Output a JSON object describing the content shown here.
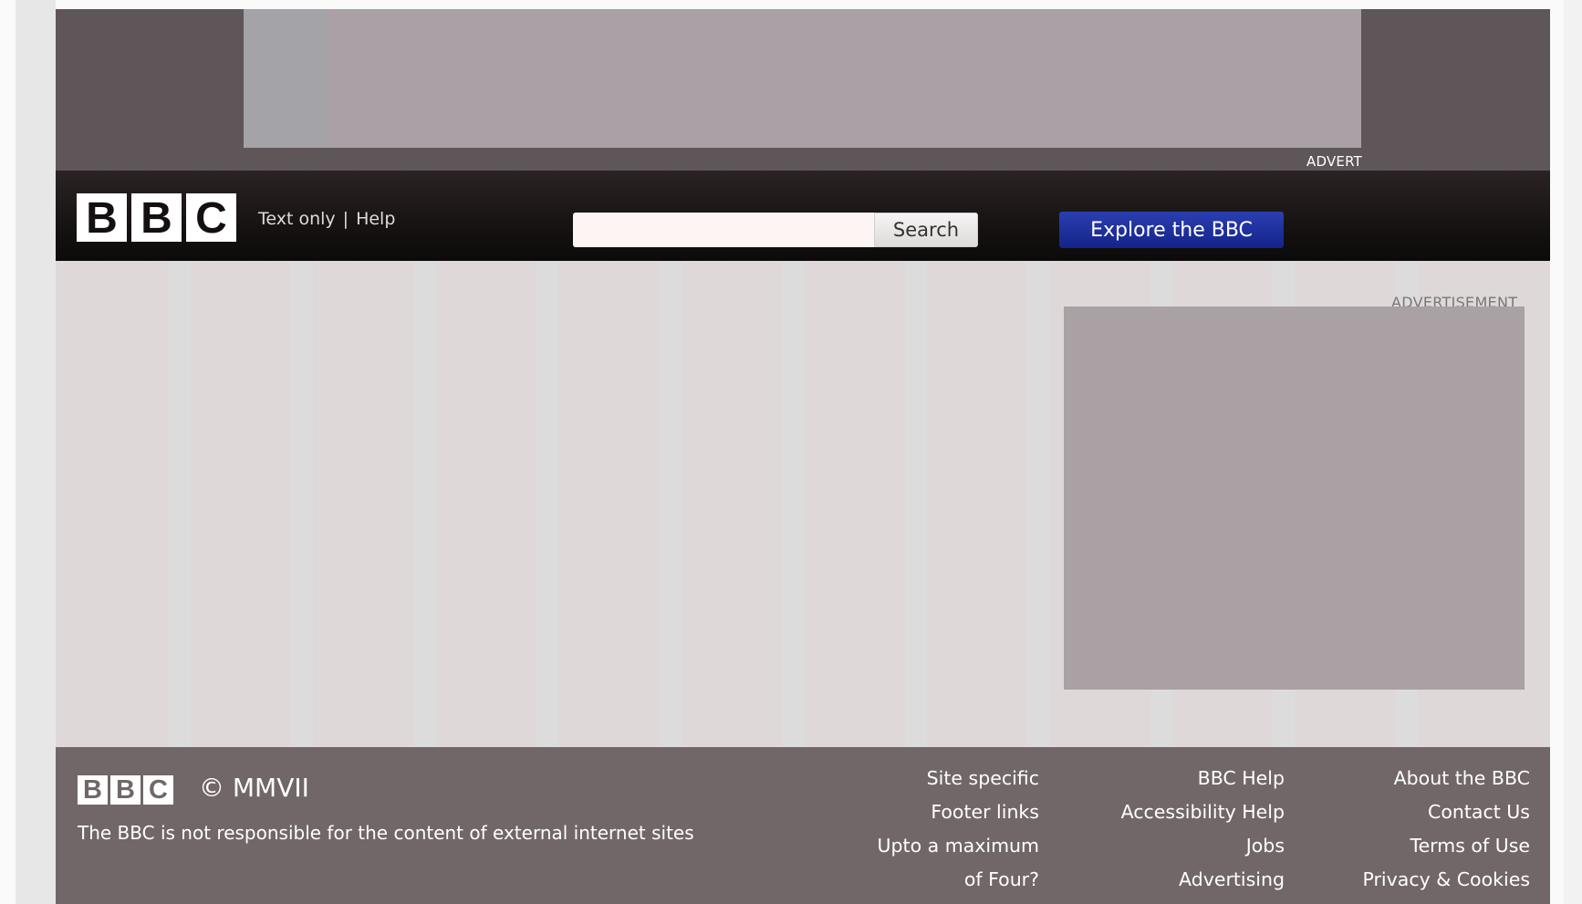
{
  "advert": {
    "label": "ADVERT"
  },
  "masthead": {
    "logo_letters": [
      "B",
      "B",
      "C"
    ],
    "util_links": [
      {
        "label": "Text only"
      },
      {
        "label": "Help"
      }
    ],
    "separator": "|",
    "search": {
      "value": "",
      "placeholder": "",
      "button_label": "Search"
    },
    "explore_label": "Explore the BBC"
  },
  "content": {
    "ad_label": "ADVERTISEMENT"
  },
  "footer": {
    "logo_letters": [
      "B",
      "B",
      "C"
    ],
    "copyright": "© MMVII",
    "disclaimer": "The BBC is not responsible for the content of external internet sites",
    "columns": [
      {
        "links": [
          "Site specific",
          "Footer links",
          "Upto a maximum",
          "of Four?"
        ]
      },
      {
        "links": [
          "BBC Help",
          "Accessibility Help",
          "Jobs",
          "Advertising"
        ]
      },
      {
        "links": [
          "About the BBC",
          "Contact Us",
          "Terms of Use",
          "Privacy & Cookies"
        ]
      }
    ]
  },
  "colors": {
    "masthead_bg": "#141010",
    "explore_button": "#1a2a9a",
    "footer_bg": "#716769",
    "content_bg": "#dfd8d9",
    "advert_bg": "#5f5659"
  }
}
